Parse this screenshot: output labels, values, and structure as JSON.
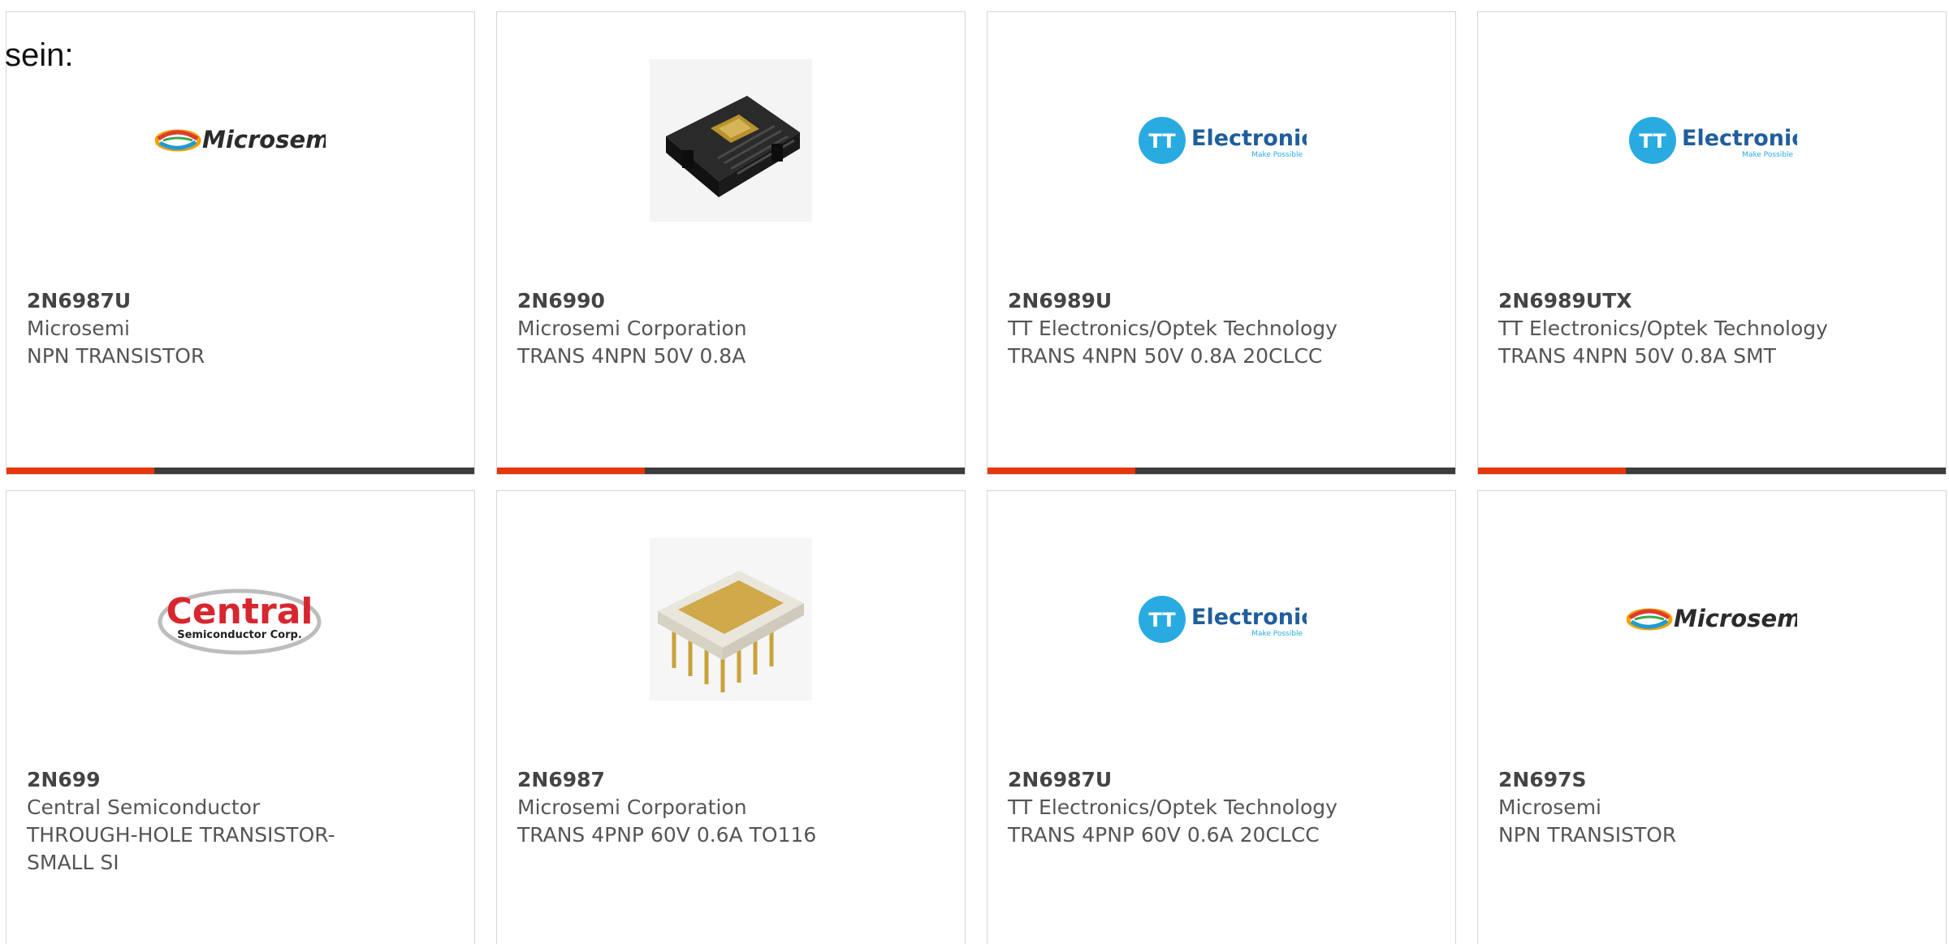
{
  "intro_text": "sein:",
  "colors": {
    "accent_bar": "#e4380c",
    "bar_track": "#3c3c3c",
    "card_border": "#d6d6d6",
    "tt_blue": "#29abe2",
    "central_red": "#d8262e"
  },
  "logos": {
    "microsemi": "Microsemi",
    "tt_mark": "TT",
    "tt_name": "Electronics",
    "tt_tagline": "Make Possible",
    "central_name": "Central",
    "central_sub": "Semiconductor Corp."
  },
  "products": [
    {
      "part_number": "2N6987U",
      "manufacturer": "Microsemi",
      "description": "NPN TRANSISTOR",
      "image": "microsemi-logo"
    },
    {
      "part_number": "2N6990",
      "manufacturer": "Microsemi Corporation",
      "description": "TRANS 4NPN 50V 0.8A",
      "image": "chip-black-package"
    },
    {
      "part_number": "2N6989U",
      "manufacturer": "TT Electronics/Optek Technology",
      "description": "TRANS 4NPN 50V 0.8A 20CLCC",
      "image": "tt-electronics-logo"
    },
    {
      "part_number": "2N6989UTX",
      "manufacturer": "TT Electronics/Optek Technology",
      "description": "TRANS 4NPN 50V 0.8A SMT",
      "image": "tt-electronics-logo"
    },
    {
      "part_number": "2N699",
      "manufacturer": "Central Semiconductor",
      "description": "THROUGH-HOLE TRANSISTOR-\nSMALL SI",
      "image": "central-semiconductor-logo"
    },
    {
      "part_number": "2N6987",
      "manufacturer": "Microsemi Corporation",
      "description": "TRANS 4PNP 60V 0.6A TO116",
      "image": "chip-gold-dip"
    },
    {
      "part_number": "2N6987U",
      "manufacturer": "TT Electronics/Optek Technology",
      "description": "TRANS 4PNP 60V 0.6A 20CLCC",
      "image": "tt-electronics-logo"
    },
    {
      "part_number": "2N697S",
      "manufacturer": "Microsemi",
      "description": "NPN TRANSISTOR",
      "image": "microsemi-logo"
    }
  ]
}
